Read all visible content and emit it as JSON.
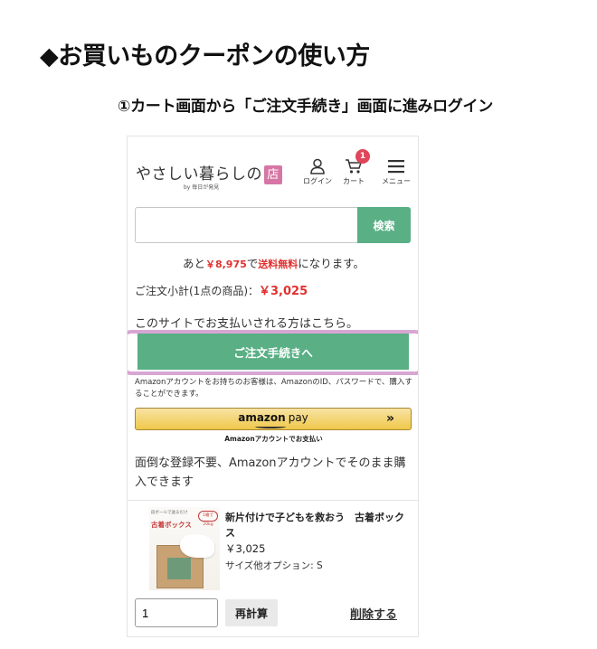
{
  "headings": {
    "main": "◆お買いものクーポンの使い方",
    "step": "①カート画面から「ご注文手続き」画面に進みログイン"
  },
  "header": {
    "logo_text": "やさしい暮らしの",
    "logo_mark": "店",
    "logo_sub": "by 毎日が発見",
    "login_label": "ログイン",
    "cart_label": "カート",
    "cart_count": "1",
    "menu_label": "メニュー"
  },
  "search": {
    "placeholder": "",
    "button_label": "検索"
  },
  "cart": {
    "free_ship_prefix": "あと",
    "free_ship_amount": "￥8,975",
    "free_ship_mid": "で",
    "free_ship_label": "送料無料",
    "free_ship_suffix": "になります。",
    "subtotal_label": "ご注文小計(1点の商品)：",
    "subtotal_value": "￥3,025",
    "pay_here_text": "このサイトでお支払いされる方はこちら。",
    "checkout_label": "ご注文手続きへ"
  },
  "amazon": {
    "note": "Amazonアカウントをお持ちのお客様は、AmazonのID、パスワードで、購入することができます。",
    "logo_word": "amazon",
    "pay_word": "pay",
    "arrow": "»",
    "caption": "Amazonアカウントでお支払い",
    "no_registration": "面倒な登録不要、Amazonアカウントでそのまま購入できます"
  },
  "product": {
    "image_text_top": "段ボールで送るだけ",
    "image_title": "古着ボックス",
    "image_badge": "1箱で20kg",
    "name": "新片付けで子どもを救おう　古着ボックス",
    "price": "￥3,025",
    "option": "サイズ他オプション: S",
    "quantity": "1",
    "recalc_label": "再計算",
    "delete_label": "削除する"
  },
  "colors": {
    "accent_green": "#5aaf85",
    "price_red": "#e23030",
    "highlight": "#d7a6d3",
    "badge_red": "#e0455a"
  }
}
